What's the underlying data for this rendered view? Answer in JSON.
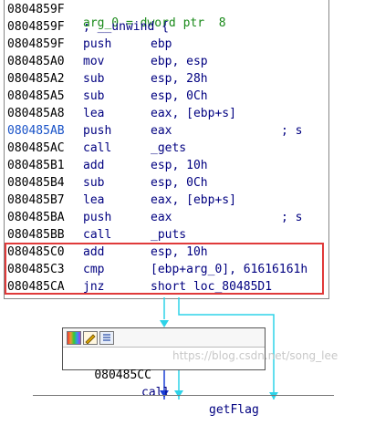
{
  "header_partial": "arg_0 = dword ptr  8",
  "main_block": {
    "lines": [
      {
        "addr": "0804859F",
        "mnemonic": "",
        "operands": "",
        "comment": ""
      },
      {
        "addr": "0804859F",
        "mnemonic": "; __unwind {",
        "operands": "",
        "comment": ""
      },
      {
        "addr": "0804859F",
        "mnemonic": "push",
        "operands": "ebp",
        "comment": ""
      },
      {
        "addr": "080485A0",
        "mnemonic": "mov",
        "operands": "ebp, esp",
        "comment": ""
      },
      {
        "addr": "080485A2",
        "mnemonic": "sub",
        "operands": "esp, 28h",
        "comment": ""
      },
      {
        "addr": "080485A5",
        "mnemonic": "sub",
        "operands": "esp, 0Ch",
        "comment": ""
      },
      {
        "addr": "080485A8",
        "mnemonic": "lea",
        "operands": "eax, [ebp+s]",
        "comment": ""
      },
      {
        "addr": "080485AB",
        "mnemonic": "push",
        "operands": "eax",
        "comment": "; s"
      },
      {
        "addr": "080485AC",
        "mnemonic": "call",
        "operands": "_gets",
        "comment": ""
      },
      {
        "addr": "080485B1",
        "mnemonic": "add",
        "operands": "esp, 10h",
        "comment": ""
      },
      {
        "addr": "080485B4",
        "mnemonic": "sub",
        "operands": "esp, 0Ch",
        "comment": ""
      },
      {
        "addr": "080485B7",
        "mnemonic": "lea",
        "operands": "eax, [ebp+s]",
        "comment": ""
      },
      {
        "addr": "080485BA",
        "mnemonic": "push",
        "operands": "eax",
        "comment": "; s"
      },
      {
        "addr": "080485BB",
        "mnemonic": "call",
        "operands": "_puts",
        "comment": ""
      },
      {
        "addr": "080485C0",
        "mnemonic": "add",
        "operands": "esp, 10h",
        "comment": ""
      },
      {
        "addr": "080485C3",
        "mnemonic": "cmp",
        "operands": "[ebp+arg_0], 61616161h",
        "comment": ""
      },
      {
        "addr": "080485CA",
        "mnemonic": "jnz",
        "operands": "short loc_80485D1",
        "comment": ""
      }
    ]
  },
  "node2": {
    "addr": "080485CC",
    "mnemonic": "call",
    "operands": "getFlag"
  },
  "watermark": "https://blog.csdn.net/song_lee",
  "colors": {
    "highlight_border": "#e03a3a",
    "edge_false": "#2ed3e8",
    "edge_true": "#1a3fd6",
    "text": "#000080",
    "current_addr": "#1a53c8"
  }
}
